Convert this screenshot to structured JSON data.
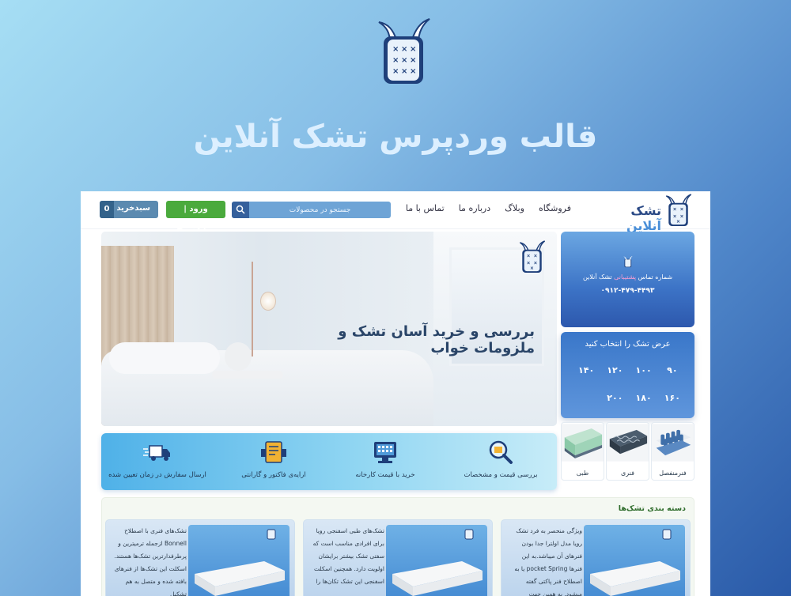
{
  "hero": {
    "title": "قالب وردپرس تشک آنلاین"
  },
  "header": {
    "cart_label": "سبدخرید",
    "cart_count": "0",
    "login_label": "ورود | نام‌نویسی",
    "search_placeholder": "جستجو در محصولات",
    "nav": [
      "فروشگاه",
      "وبلاگ",
      "درباره ما",
      "تماس با ما"
    ],
    "brand": {
      "part1": "تشک",
      "part2": "آنلاین"
    }
  },
  "slider": {
    "headline": "بررسی و خرید آسان تشک و ملزومات خواب"
  },
  "support": {
    "text_prefix": "شماره تماس",
    "text_highlight": "پشتیبانی",
    "text_suffix": "تشک آنلاین",
    "phone": "۰۹۱۲-۴۷۹-۴۴۹۳"
  },
  "width_picker": {
    "title": "عرض تشک را انتخاب کنید",
    "options": [
      "۹۰",
      "۱۰۰",
      "۱۲۰",
      "۱۴۰",
      "۱۶۰",
      "۱۸۰",
      "۲۰۰"
    ]
  },
  "categories": [
    {
      "label": "فنرمنفصل",
      "icon": "pocket-spring-icon"
    },
    {
      "label": "فنری",
      "icon": "spring-icon"
    },
    {
      "label": "طبی",
      "icon": "foam-icon"
    }
  ],
  "features": [
    {
      "label": "بررسی قیمت و مشخصات",
      "icon": "magnifier-icon"
    },
    {
      "label": "خرید با قیمت کارخانه",
      "icon": "factory-icon"
    },
    {
      "label": "ارایه‌ی فاکتور و گارانتی",
      "icon": "invoice-icon"
    },
    {
      "label": "ارسال سفارش در زمان تعیین شده",
      "icon": "truck-icon"
    }
  ],
  "section": {
    "title": "دسته بندی تشک‌ها",
    "products": [
      {
        "text": "ویژگی منحصر به فرد تشک رویا مدل اولترا جدا بودن فنرهای آن میباشد.به این فنرها pocket Spring یا به اصطلاح فنر پاکتی گفته میشود. به همین جهت"
      },
      {
        "text": "تشک‌های طبی اسفنجی رویا برای افرادی مناسب است که سفتی تشک بیشتر برایشان اولویت دارد. همچنین اسکلت اسفنجی این تشک تکان‌ها را"
      },
      {
        "text": "تشک‌های فنری با اصطلاح Bonnell ازجمله ترمیترین و پرطرفدارترین تشک‌ها هستند. اسکلت این تشک‌ها از فنرهای بافته شده و متصل به هم تشکیل"
      }
    ]
  },
  "colors": {
    "brand_dark": "#2b4a86",
    "brand_light": "#4a8fd8",
    "login_green": "#4aaa3c",
    "cart": "#5b8ab0"
  }
}
